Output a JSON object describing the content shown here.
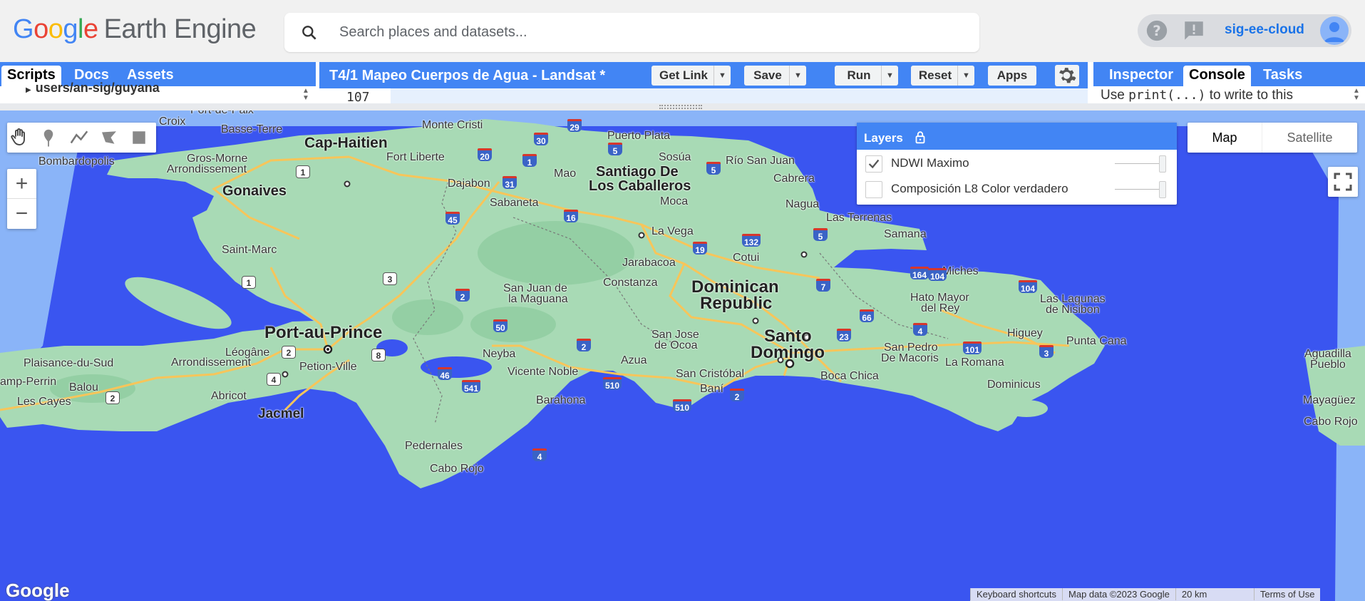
{
  "header": {
    "logo_text": "Google",
    "product": "Earth Engine",
    "search_placeholder": "Search places and datasets...",
    "user": "sig-ee-cloud",
    "icons": [
      "help-icon",
      "feedback-icon",
      "account-icon"
    ]
  },
  "left_panel": {
    "tabs": [
      {
        "label": "Scripts",
        "active": true
      },
      {
        "label": "Docs",
        "active": false
      },
      {
        "label": "Assets",
        "active": false
      }
    ],
    "tree_item": "users/an-sig/guyana"
  },
  "center_panel": {
    "script_title": "T4/1 Mapeo Cuerpos de Agua - Landsat *",
    "buttons": {
      "get_link": "Get Link",
      "save": "Save",
      "run": "Run",
      "reset": "Reset",
      "apps": "Apps"
    },
    "editor_line": "107"
  },
  "right_panel": {
    "tabs": [
      {
        "label": "Inspector",
        "active": false
      },
      {
        "label": "Console",
        "active": true
      },
      {
        "label": "Tasks",
        "active": false
      }
    ],
    "console_text_before": "Use ",
    "console_code": "print(...)",
    "console_text_after": " to write to this"
  },
  "map": {
    "layers_title": "Layers",
    "layers": [
      {
        "name": "NDWI Maximo",
        "checked": true
      },
      {
        "name": "Composición L8 Color verdadero",
        "checked": false
      }
    ],
    "map_types": {
      "map": "Map",
      "satellite": "Satellite",
      "selected": "Map"
    },
    "zoom_in": "+",
    "zoom_out": "−",
    "google_logo": "Google",
    "attribution": {
      "shortcuts": "Keyboard shortcuts",
      "data": "Map data ©2023 Google",
      "scale": "20 km",
      "terms": "Terms of Use"
    },
    "labels": {
      "port_de_paix": "Port-de-Paix",
      "croix": "Croix",
      "basse_terre": "Basse-Terre",
      "cap_haitien": "Cap-Haitien",
      "monte_cristi": "Monte Cristi",
      "puerto_plata": "Puerto Plata",
      "sosua": "Sosúa",
      "rio_san_juan": "Río San Juan",
      "cabrera": "Cabrera",
      "bombardopolis": "Bombardopolis",
      "gros_morne": "Gros-Morne",
      "arrondissement1": "Arrondissement",
      "fort_liberte": "Fort Liberte",
      "mao": "Mao",
      "santiago1": "Santiago De",
      "santiago2": "Los Caballeros",
      "gonaives": "Gonaives",
      "dajabon": "Dajabon",
      "sabaneta": "Sabaneta",
      "moca": "Moca",
      "nagua": "Nagua",
      "las_terrenas": "Las Terrenas",
      "samana": "Samana",
      "la_vega": "La Vega",
      "saint_marc": "Saint-Marc",
      "jarabacoa": "Jarabacoa",
      "cotui": "Cotui",
      "miches": "Miches",
      "dominican1": "Dominican",
      "dominican2": "Republic",
      "constanza": "Constanza",
      "san_juan1": "San Juan de",
      "san_juan2": "la Maguana",
      "hato_mayor1": "Hato Mayor",
      "hato_mayor2": "del Rey",
      "las_lagunas1": "Las Lagunas",
      "las_lagunas2": "de Nisibon",
      "port_au_prince": "Port-au-Prince",
      "san_jose1": "San Jose",
      "san_jose2": "de Ocoa",
      "santo1": "Santo",
      "santo2": "Domingo",
      "higuey": "Higuey",
      "punta_cana": "Punta Cana",
      "leogane": "Léogâne",
      "arrondissement2": "Arrondissement",
      "petion_ville": "Petion-Ville",
      "neyba": "Neyba",
      "azua": "Azua",
      "san_pedro1": "San Pedro",
      "san_pedro2": "De Macoris",
      "la_romana": "La Romana",
      "aguadilla": "Aguadilla",
      "pueblo": "Pueblo",
      "plaisance": "Plaisance-du-Sud",
      "camp_perrin": "amp-Perrin",
      "balou": "Balou",
      "abricot": "Abricot",
      "vicente_noble": "Vicente Noble",
      "san_cristobal": "San Cristóbal",
      "bani": "Baní",
      "boca_chica": "Boca Chica",
      "dominicus": "Dominicus",
      "mayaguez": "Mayagüez",
      "les_cayes": "Les Cayes",
      "jacmel": "Jacmel",
      "barahona": "Barahona",
      "cabo_rojo_pr": "Cabo Rojo",
      "pedernales": "Pedernales",
      "cabo_rojo": "Cabo Rojo"
    },
    "routes": [
      "29",
      "30",
      "20",
      "5",
      "1",
      "31",
      "5",
      "1",
      "16",
      "45",
      "132",
      "19",
      "5",
      "3",
      "1",
      "2",
      "7",
      "104",
      "164",
      "104",
      "66",
      "50",
      "4",
      "2",
      "23",
      "101",
      "3",
      "2",
      "8",
      "4",
      "2",
      "46",
      "541",
      "510",
      "510",
      "2",
      "4"
    ]
  },
  "colors": {
    "accent": "#4285f4",
    "water": "#3a55f0",
    "land": "#a8dab5",
    "road": "#f7c55a"
  }
}
